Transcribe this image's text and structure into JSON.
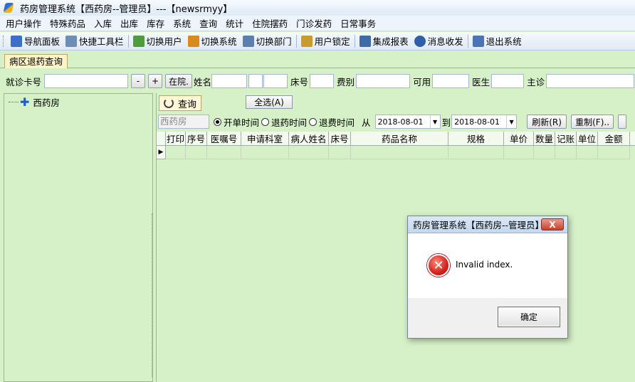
{
  "window": {
    "title": "药房管理系统【西药房--管理员】---【newsrmyy】"
  },
  "menu": [
    "用户操作",
    "特殊药品",
    "入库",
    "出库",
    "库存",
    "系统",
    "查询",
    "统计",
    "住院摆药",
    "门诊发药",
    "日常事务"
  ],
  "toolbar": [
    {
      "label": "导航面板",
      "icon": "navigation-panel-icon",
      "color": "#3b6fc9"
    },
    {
      "label": "快捷工具栏",
      "icon": "shortcut-toolbar-icon",
      "color": "#6d8fb5"
    },
    {
      "label": "切换用户",
      "icon": "switch-user-icon",
      "color": "#4d9c3d"
    },
    {
      "label": "切换系统",
      "icon": "switch-system-icon",
      "color": "#d98a1e"
    },
    {
      "label": "切换部门",
      "icon": "switch-department-icon",
      "color": "#5b7fb0"
    },
    {
      "label": "用户锁定",
      "icon": "user-lock-icon",
      "color": "#c99a2e"
    },
    {
      "label": "集成报表",
      "icon": "report-icon",
      "color": "#3f6aa8"
    },
    {
      "label": "消息收发",
      "icon": "message-icon",
      "color": "#2e5fa8"
    },
    {
      "label": "退出系统",
      "icon": "exit-icon",
      "color": "#4a74b4"
    }
  ],
  "tab": {
    "label": "病区退药查询"
  },
  "search": {
    "card_label": "就诊卡号",
    "minus": "-",
    "plus": "+",
    "status_button": "在院.",
    "name_label": "姓名",
    "bed_label": "床号",
    "fee_label": "费别",
    "available_label": "可用",
    "doctor_label": "医生",
    "attending_label": "主诊"
  },
  "tree": {
    "root": "西药房"
  },
  "query": {
    "tab_label": "查询",
    "select_all": "全选(A)",
    "department": "西药房",
    "radios": [
      {
        "label": "开单时间",
        "checked": true
      },
      {
        "label": "退药时间",
        "checked": false
      },
      {
        "label": "退费时间",
        "checked": false
      }
    ],
    "from_label": "从",
    "from_date": "2018-08-01",
    "to_label": "到",
    "to_date": "2018-08-01",
    "refresh": "刷新(R)",
    "reprint": "重制(F).."
  },
  "grid": {
    "columns": [
      "打印",
      "序号",
      "医嘱号",
      "申请科室",
      "病人姓名",
      "床号",
      "药品名称",
      "规格",
      "单价",
      "数量",
      "记账",
      "单位",
      "金额"
    ]
  },
  "dialog": {
    "title": "药房管理系统【西药房--管理员】",
    "close": "X",
    "message": "Invalid index.",
    "ok": "确定"
  },
  "colors": {
    "background": "#d6f0c8",
    "tab_active": "#fff3c8",
    "error": "#d4221c"
  }
}
